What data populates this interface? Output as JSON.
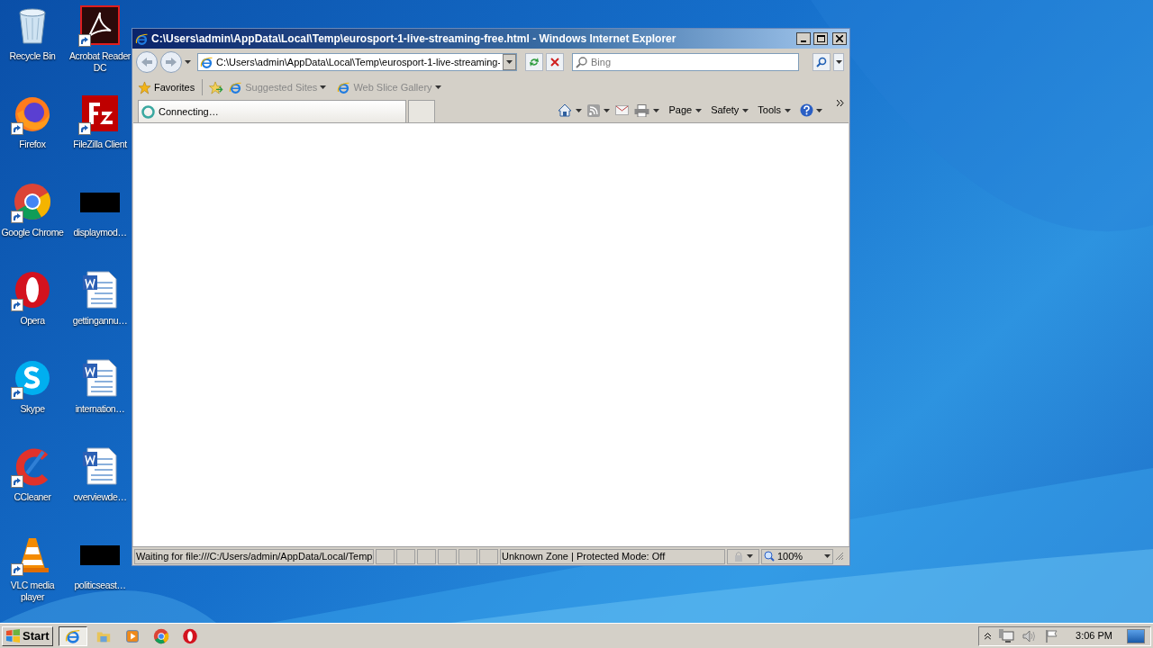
{
  "desktop_icons": [
    {
      "label": "Recycle Bin",
      "kind": "bin",
      "shortcut": false
    },
    {
      "label": "Firefox",
      "kind": "firefox",
      "shortcut": true
    },
    {
      "label": "Google Chrome",
      "kind": "chrome",
      "shortcut": true
    },
    {
      "label": "Opera",
      "kind": "opera",
      "shortcut": true
    },
    {
      "label": "Skype",
      "kind": "skype",
      "shortcut": true
    },
    {
      "label": "CCleaner",
      "kind": "ccleaner",
      "shortcut": true
    },
    {
      "label": "VLC media player",
      "kind": "vlc",
      "shortcut": true
    },
    {
      "label": "Acrobat Reader DC",
      "kind": "acrobat",
      "shortcut": true
    },
    {
      "label": "FileZilla Client",
      "kind": "filezilla",
      "shortcut": true
    },
    {
      "label": "displaymod…",
      "kind": "black",
      "shortcut": false
    },
    {
      "label": "gettingannu…",
      "kind": "word",
      "shortcut": false
    },
    {
      "label": "internation…",
      "kind": "word",
      "shortcut": false
    },
    {
      "label": "overviewde…",
      "kind": "word",
      "shortcut": false
    },
    {
      "label": "politicseast…",
      "kind": "black",
      "shortcut": false
    }
  ],
  "window": {
    "title": "C:\\Users\\admin\\AppData\\Local\\Temp\\eurosport-1-live-streaming-free.html - Windows Internet Explorer",
    "address": "C:\\Users\\admin\\AppData\\Local\\Temp\\eurosport-1-live-streaming-",
    "search": {
      "placeholder": "Bing"
    },
    "favorites": {
      "label": "Favorites",
      "links": [
        "Suggested Sites",
        "Web Slice Gallery"
      ]
    },
    "tab": {
      "label": "Connecting…"
    },
    "commands": [
      "Page",
      "Safety",
      "Tools"
    ],
    "status_bar": {
      "text": "Waiting for file:///C:/Users/admin/AppData/Local/Temp",
      "zone": "Unknown Zone | Protected Mode: Off",
      "zoom": "100%"
    }
  },
  "taskbar": {
    "start": "Start",
    "items": [
      {
        "kind": "ie",
        "selected": true
      },
      {
        "kind": "folder",
        "selected": false
      },
      {
        "kind": "media",
        "selected": false
      },
      {
        "kind": "chrome",
        "selected": false
      },
      {
        "kind": "opera",
        "selected": false
      }
    ],
    "clock": "3:06 PM"
  }
}
